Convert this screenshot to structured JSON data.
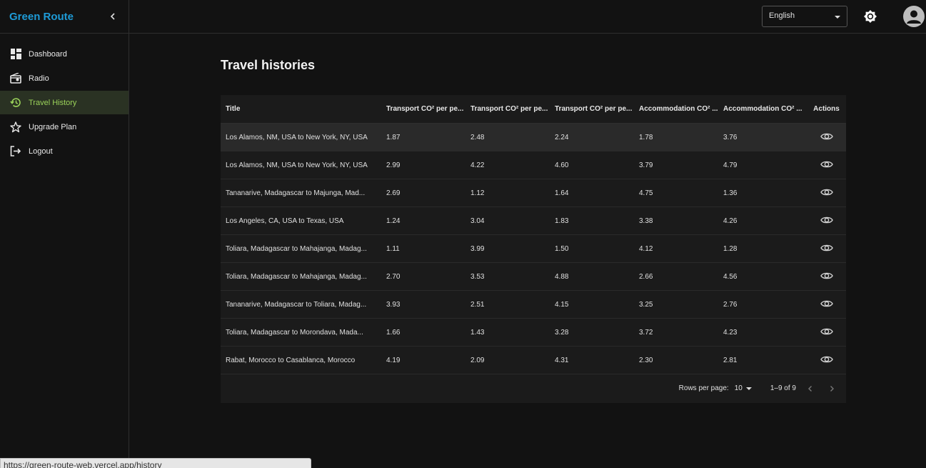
{
  "app": {
    "brand": "Green Route"
  },
  "sidebar": {
    "items": [
      {
        "label": "Dashboard",
        "icon": "dashboard-icon",
        "active": false
      },
      {
        "label": "Radio",
        "icon": "radio-icon",
        "active": false
      },
      {
        "label": "Travel History",
        "icon": "history-icon",
        "active": true
      },
      {
        "label": "Upgrade Plan",
        "icon": "star-icon",
        "active": false
      },
      {
        "label": "Logout",
        "icon": "logout-icon",
        "active": false
      }
    ]
  },
  "topbar": {
    "language": "English"
  },
  "page": {
    "title": "Travel histories"
  },
  "table": {
    "headers": [
      "Title",
      "Transport CO² per pe...",
      "Transport CO² per pe...",
      "Transport CO² per pe...",
      "Accommodation CO² ...",
      "Accommodation CO² ...",
      "Actions"
    ],
    "rows": [
      [
        "Los Alamos, NM, USA to New York, NY, USA",
        "1.87",
        "2.48",
        "2.24",
        "1.78",
        "3.76"
      ],
      [
        "Los Alamos, NM, USA to New York, NY, USA",
        "2.99",
        "4.22",
        "4.60",
        "3.79",
        "4.79"
      ],
      [
        "Tananarive, Madagascar to Majunga, Mad...",
        "2.69",
        "1.12",
        "1.64",
        "4.75",
        "1.36"
      ],
      [
        "Los Angeles, CA, USA to Texas, USA",
        "1.24",
        "3.04",
        "1.83",
        "3.38",
        "4.26"
      ],
      [
        "Toliara, Madagascar to Mahajanga, Madag...",
        "1.11",
        "3.99",
        "1.50",
        "4.12",
        "1.28"
      ],
      [
        "Toliara, Madagascar to Mahajanga, Madag...",
        "2.70",
        "3.53",
        "4.88",
        "2.66",
        "4.56"
      ],
      [
        "Tananarive, Madagascar to Toliara, Madag...",
        "3.93",
        "2.51",
        "4.15",
        "3.25",
        "2.76"
      ],
      [
        "Toliara, Madagascar to Morondava, Mada...",
        "1.66",
        "1.43",
        "3.28",
        "3.72",
        "4.23"
      ],
      [
        "Rabat, Morocco to Casablanca, Morocco",
        "4.19",
        "2.09",
        "4.31",
        "2.30",
        "2.81"
      ]
    ]
  },
  "pagination": {
    "rows_per_page_label": "Rows per page:",
    "rows_per_page": "10",
    "range": "1–9 of 9"
  },
  "status_bar": {
    "url": "https://green-route-web.vercel.app/history"
  },
  "colors": {
    "brand": "#1e9bd7",
    "active_nav": "#9bd35a",
    "background": "#121212"
  }
}
